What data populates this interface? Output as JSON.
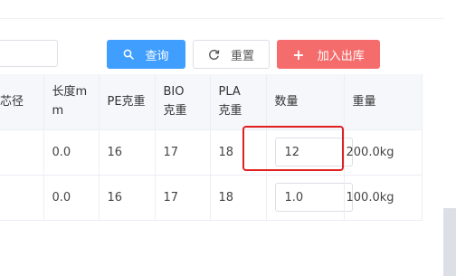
{
  "toolbar": {
    "query_label": "查询",
    "reset_label": "重置",
    "add_label": "加入出库",
    "add_symbol": "+"
  },
  "table": {
    "headers": {
      "core_diameter": "芯径",
      "length": "长度mm",
      "pe_weight": "PE克重",
      "bio_weight": "BIO克重",
      "pla_weight": "PLA克重",
      "quantity": "数量",
      "weight": "重量"
    },
    "rows": [
      {
        "core_diameter": "",
        "length": "0.0",
        "pe_weight": "16",
        "bio_weight": "17",
        "pla_weight": "18",
        "quantity": "12",
        "weight": "200.0kg"
      },
      {
        "core_diameter": "",
        "length": "0.0",
        "pe_weight": "16",
        "bio_weight": "17",
        "pla_weight": "18",
        "quantity": "1.0",
        "weight": "100.0kg"
      }
    ]
  },
  "colors": {
    "primary": "#409eff",
    "danger": "#f56c6c",
    "highlight": "#e02020",
    "header_bg": "#f5f7fa"
  },
  "icons": [
    "search-icon",
    "refresh-icon",
    "plus-icon"
  ]
}
